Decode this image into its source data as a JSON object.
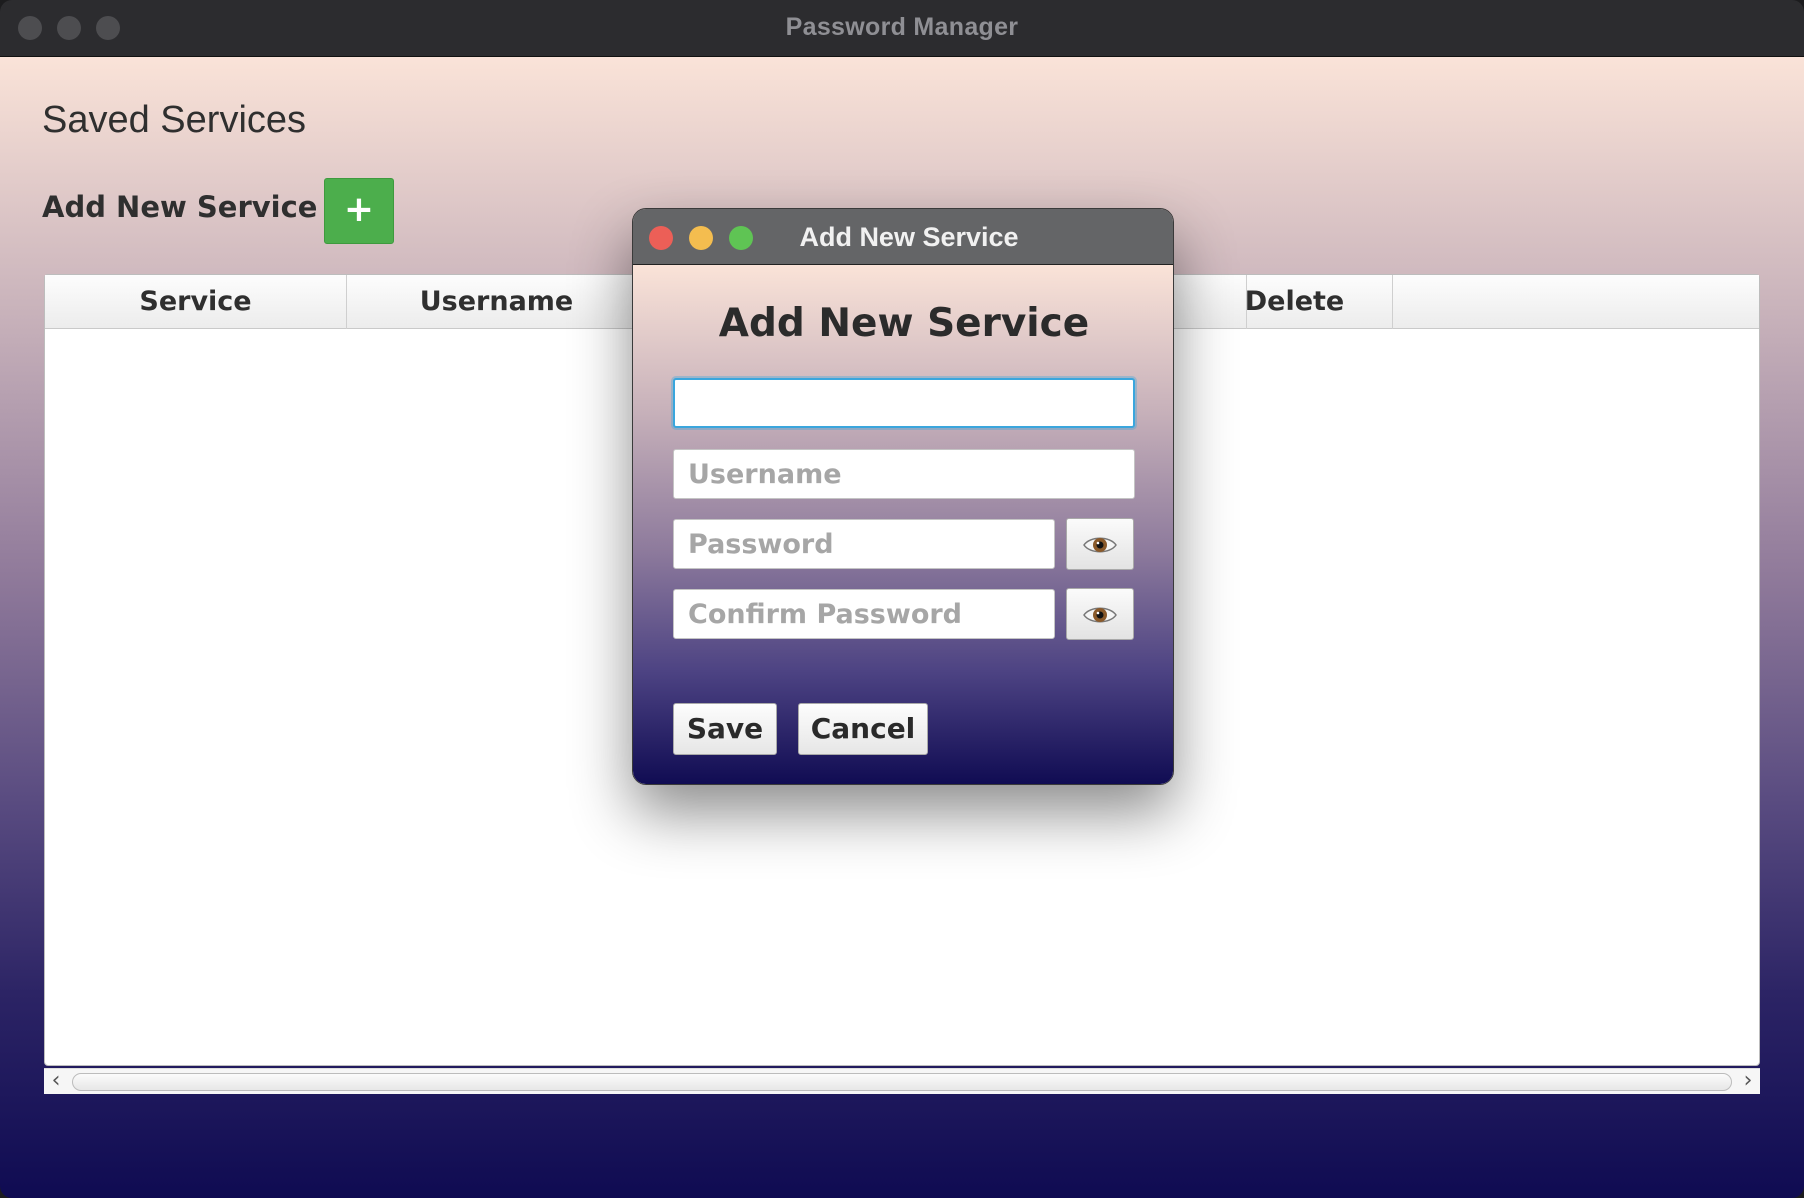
{
  "window": {
    "title": "Password Manager"
  },
  "main": {
    "heading": "Saved Services",
    "add_label": "Add New Service",
    "add_button": "+",
    "table": {
      "columns": [
        "Service",
        "Username",
        "Delete"
      ]
    }
  },
  "dialog": {
    "title": "Add New Service",
    "heading": "Add New Service",
    "fields": {
      "service": {
        "value": "",
        "placeholder": ""
      },
      "username": {
        "value": "",
        "placeholder": "Username"
      },
      "password": {
        "value": "",
        "placeholder": "Password"
      },
      "confirm_password": {
        "value": "",
        "placeholder": "Confirm Password"
      }
    },
    "save_label": "Save",
    "cancel_label": "Cancel"
  },
  "icons": {
    "reveal_password": "eye-icon",
    "reveal_confirm": "eye-icon"
  },
  "colors": {
    "add_button": "#4cae4c",
    "focus_ring": "#3aa6dd",
    "traffic_close": "#ec5f57",
    "traffic_minimize": "#f4bd4f",
    "traffic_zoom": "#5fc454"
  }
}
